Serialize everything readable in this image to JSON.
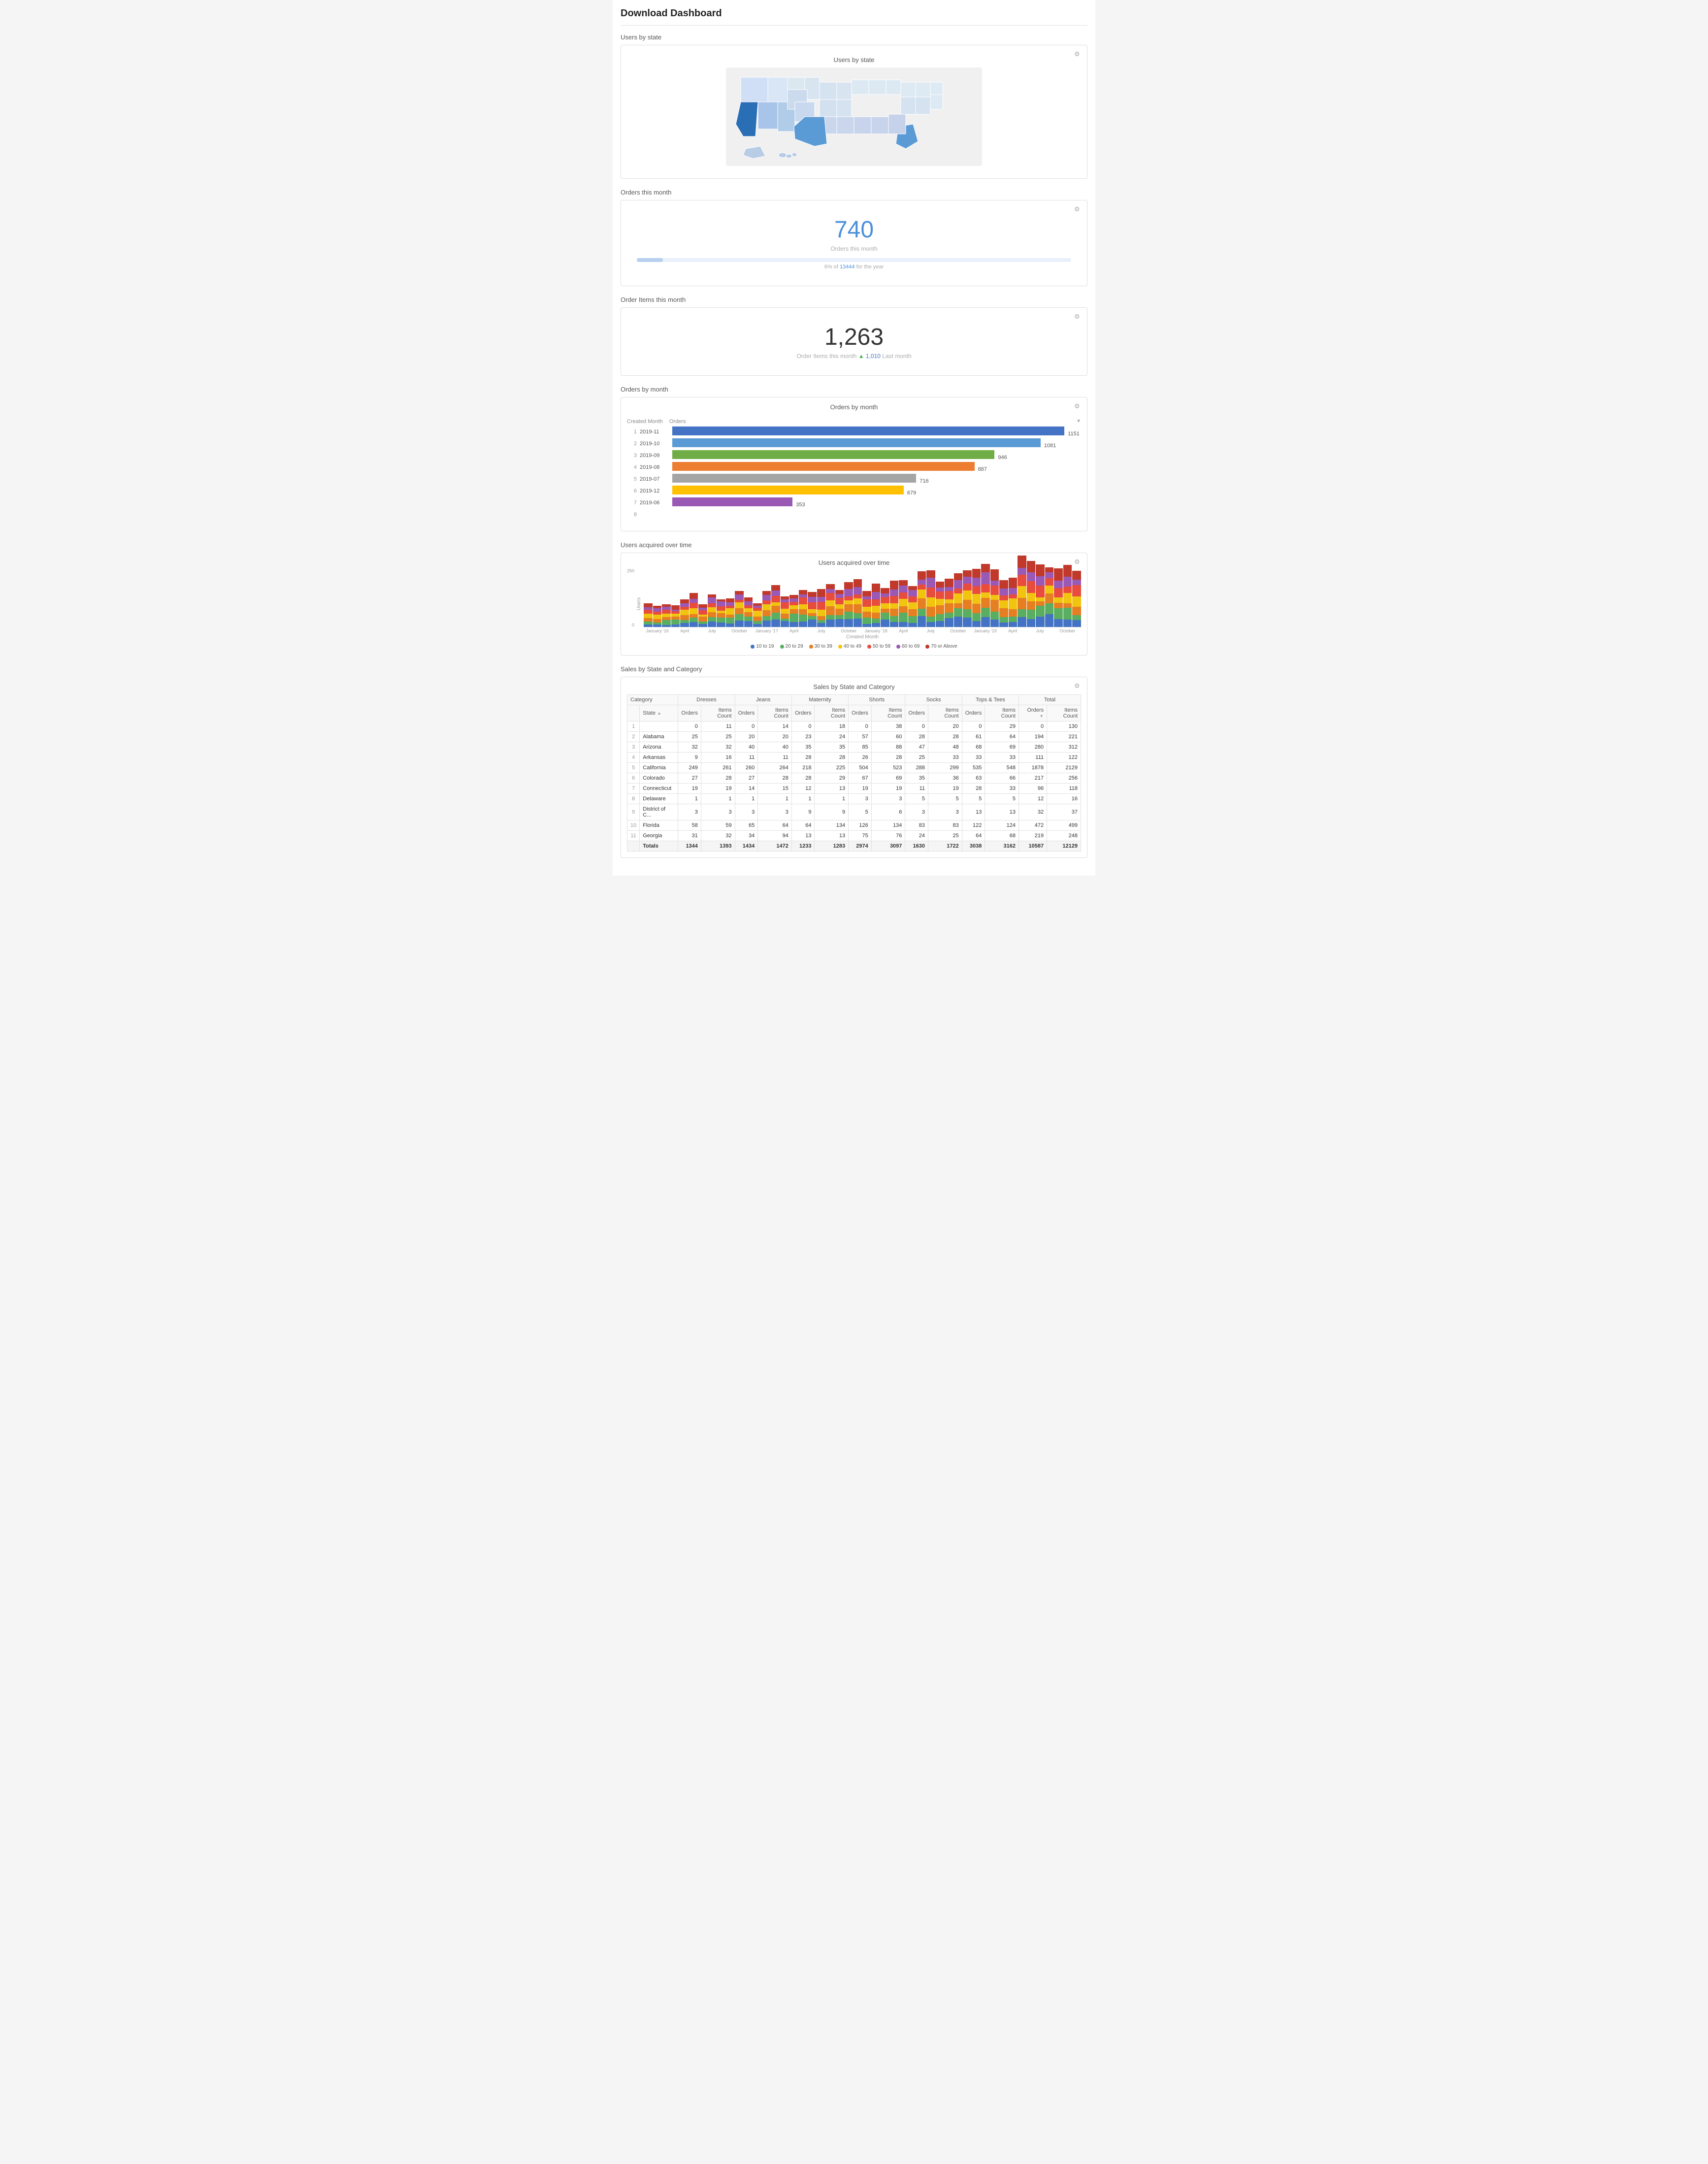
{
  "title": "Download Dashboard",
  "sections": {
    "users_by_state": {
      "label": "Users by state",
      "chart_title": "Users by state"
    },
    "orders_this_month": {
      "label": "Orders this month",
      "value": "740",
      "sub_label": "Orders this month",
      "progress_text": "6% of 13444 for the year",
      "progress_pct": 6
    },
    "order_items_this_month": {
      "label": "Order Items this month",
      "value": "1,263",
      "sub_label": "Order Items this month",
      "last_month_label": "Last month",
      "last_month_value": "1,010"
    },
    "orders_by_month": {
      "label": "Orders by month",
      "chart_title": "Orders by month",
      "col_created": "Created Month",
      "col_orders": "Orders",
      "rows": [
        {
          "num": 1,
          "month": "2019-11",
          "orders": 1151,
          "color": "#4472c4"
        },
        {
          "num": 2,
          "month": "2019-10",
          "orders": 1081,
          "color": "#5b9bd5"
        },
        {
          "num": 3,
          "month": "2019-09",
          "orders": 946,
          "color": "#70ad47"
        },
        {
          "num": 4,
          "month": "2019-08",
          "orders": 887,
          "color": "#ed7d31"
        },
        {
          "num": 5,
          "month": "2019-07",
          "orders": 716,
          "color": "#a5a5a5"
        },
        {
          "num": 6,
          "month": "2019-12",
          "orders": 679,
          "color": "#ffc000"
        },
        {
          "num": 7,
          "month": "2019-06",
          "orders": 353,
          "color": "#9b59b6"
        },
        {
          "num": 8,
          "month": "",
          "orders": 0,
          "color": "#e74c3c"
        }
      ],
      "max_orders": 1200
    },
    "users_acquired": {
      "label": "Users acquired over time",
      "chart_title": "Users acquired over time",
      "y_label": "Users",
      "y_ticks": [
        "250",
        "0"
      ],
      "x_labels": [
        "January '16",
        "April",
        "July",
        "October",
        "January '17",
        "April",
        "July",
        "October",
        "January '18",
        "April",
        "July",
        "October",
        "January '19",
        "April",
        "July",
        "October"
      ],
      "legend": [
        {
          "label": "10 to 19",
          "color": "#4472c4"
        },
        {
          "label": "20 to 29",
          "color": "#5aae61"
        },
        {
          "label": "30 to 39",
          "color": "#e67e22"
        },
        {
          "label": "40 to 49",
          "color": "#f1c40f"
        },
        {
          "label": "50 to 59",
          "color": "#e74c3c"
        },
        {
          "label": "60 to 69",
          "color": "#9b59b6"
        },
        {
          "label": "70 or Above",
          "color": "#c0392b"
        }
      ]
    },
    "sales_table": {
      "label": "Sales by State and Category",
      "chart_title": "Sales by State and Category",
      "categories": [
        "Dresses",
        "Jeans",
        "Maternity",
        "Shorts",
        "Socks",
        "Tops & Tees",
        "Total"
      ],
      "col_state": "State",
      "col_orders": "Orders",
      "col_items": "Items Count",
      "rows": [
        {
          "num": 1,
          "state": "",
          "dresses_orders": 0,
          "dresses_items": 11,
          "jeans_orders": 0,
          "jeans_items": 14,
          "maternity_orders": 0,
          "maternity_items": 18,
          "shorts_orders": 0,
          "shorts_items": 38,
          "socks_orders": 0,
          "socks_items": 20,
          "tops_orders": 0,
          "tops_items": 29,
          "total_orders": 0,
          "total_items": 130
        },
        {
          "num": 2,
          "state": "Alabama",
          "dresses_orders": 25,
          "dresses_items": 25,
          "jeans_orders": 20,
          "jeans_items": 20,
          "maternity_orders": 23,
          "maternity_items": 24,
          "shorts_orders": 57,
          "shorts_items": 60,
          "socks_orders": 28,
          "socks_items": 28,
          "tops_orders": 61,
          "tops_items": 64,
          "total_orders": 194,
          "total_items": 221
        },
        {
          "num": 3,
          "state": "Arizona",
          "dresses_orders": 32,
          "dresses_items": 32,
          "jeans_orders": 40,
          "jeans_items": 40,
          "maternity_orders": 35,
          "maternity_items": 35,
          "shorts_orders": 85,
          "shorts_items": 88,
          "socks_orders": 47,
          "socks_items": 48,
          "tops_orders": 68,
          "tops_items": 69,
          "total_orders": 280,
          "total_items": 312
        },
        {
          "num": 4,
          "state": "Arkansas",
          "dresses_orders": 9,
          "dresses_items": 16,
          "jeans_orders": 11,
          "jeans_items": 11,
          "maternity_orders": 28,
          "maternity_items": 28,
          "shorts_orders": 26,
          "shorts_items": 28,
          "socks_orders": 25,
          "socks_items": 33,
          "tops_orders": 33,
          "tops_items": 33,
          "total_orders": 111,
          "total_items": 122
        },
        {
          "num": 5,
          "state": "California",
          "dresses_orders": 249,
          "dresses_items": 261,
          "jeans_orders": 260,
          "jeans_items": 264,
          "maternity_orders": 218,
          "maternity_items": 225,
          "shorts_orders": 504,
          "shorts_items": 523,
          "socks_orders": 288,
          "socks_items": 299,
          "tops_orders": 535,
          "tops_items": 548,
          "total_orders": 1878,
          "total_items": 2129
        },
        {
          "num": 6,
          "state": "Colorado",
          "dresses_orders": 27,
          "dresses_items": 28,
          "jeans_orders": 27,
          "jeans_items": 28,
          "maternity_orders": 28,
          "maternity_items": 29,
          "shorts_orders": 67,
          "shorts_items": 69,
          "socks_orders": 35,
          "socks_items": 36,
          "tops_orders": 63,
          "tops_items": 66,
          "total_orders": 217,
          "total_items": 256
        },
        {
          "num": 7,
          "state": "Connecticut",
          "dresses_orders": 19,
          "dresses_items": 19,
          "jeans_orders": 14,
          "jeans_items": 15,
          "maternity_orders": 12,
          "maternity_items": 13,
          "shorts_orders": 19,
          "shorts_items": 19,
          "socks_orders": 11,
          "socks_items": 19,
          "tops_orders": 28,
          "tops_items": 33,
          "total_orders": 96,
          "total_items": 118
        },
        {
          "num": 8,
          "state": "Delaware",
          "dresses_orders": 1,
          "dresses_items": 1,
          "jeans_orders": 1,
          "jeans_items": 1,
          "maternity_orders": 1,
          "maternity_items": 1,
          "shorts_orders": 3,
          "shorts_items": 3,
          "socks_orders": 5,
          "socks_items": 5,
          "tops_orders": 5,
          "tops_items": 5,
          "total_orders": 12,
          "total_items": 16
        },
        {
          "num": 9,
          "state": "District of C...",
          "dresses_orders": 3,
          "dresses_items": 3,
          "jeans_orders": 3,
          "jeans_items": 3,
          "maternity_orders": 9,
          "maternity_items": 9,
          "shorts_orders": 5,
          "shorts_items": 6,
          "socks_orders": 3,
          "socks_items": 3,
          "tops_orders": 13,
          "tops_items": 13,
          "total_orders": 32,
          "total_items": 37
        },
        {
          "num": 10,
          "state": "Florida",
          "dresses_orders": 58,
          "dresses_items": 59,
          "jeans_orders": 65,
          "jeans_items": 64,
          "maternity_orders": 64,
          "maternity_items": 134,
          "shorts_orders": 126,
          "shorts_items": 134,
          "socks_orders": 83,
          "socks_items": 83,
          "tops_orders": 122,
          "tops_items": 124,
          "total_orders": 472,
          "total_items": 499
        },
        {
          "num": 11,
          "state": "Georgia",
          "dresses_orders": 31,
          "dresses_items": 32,
          "jeans_orders": 34,
          "jeans_items": 94,
          "maternity_orders": 13,
          "maternity_items": 13,
          "shorts_orders": 75,
          "shorts_items": 76,
          "socks_orders": 24,
          "socks_items": 25,
          "tops_orders": 64,
          "tops_items": 68,
          "total_orders": 219,
          "total_items": 248
        }
      ],
      "totals": {
        "state": "Totals",
        "dresses_orders": 1344,
        "dresses_items": 1393,
        "jeans_orders": 1434,
        "jeans_items": 1472,
        "maternity_orders": 1233,
        "maternity_items": 1283,
        "shorts_orders": 2974,
        "shorts_items": 3097,
        "socks_orders": 1630,
        "socks_items": 1722,
        "tops_orders": 3038,
        "tops_items": 3162,
        "total_orders": 10587,
        "total_items": 12129
      }
    }
  }
}
